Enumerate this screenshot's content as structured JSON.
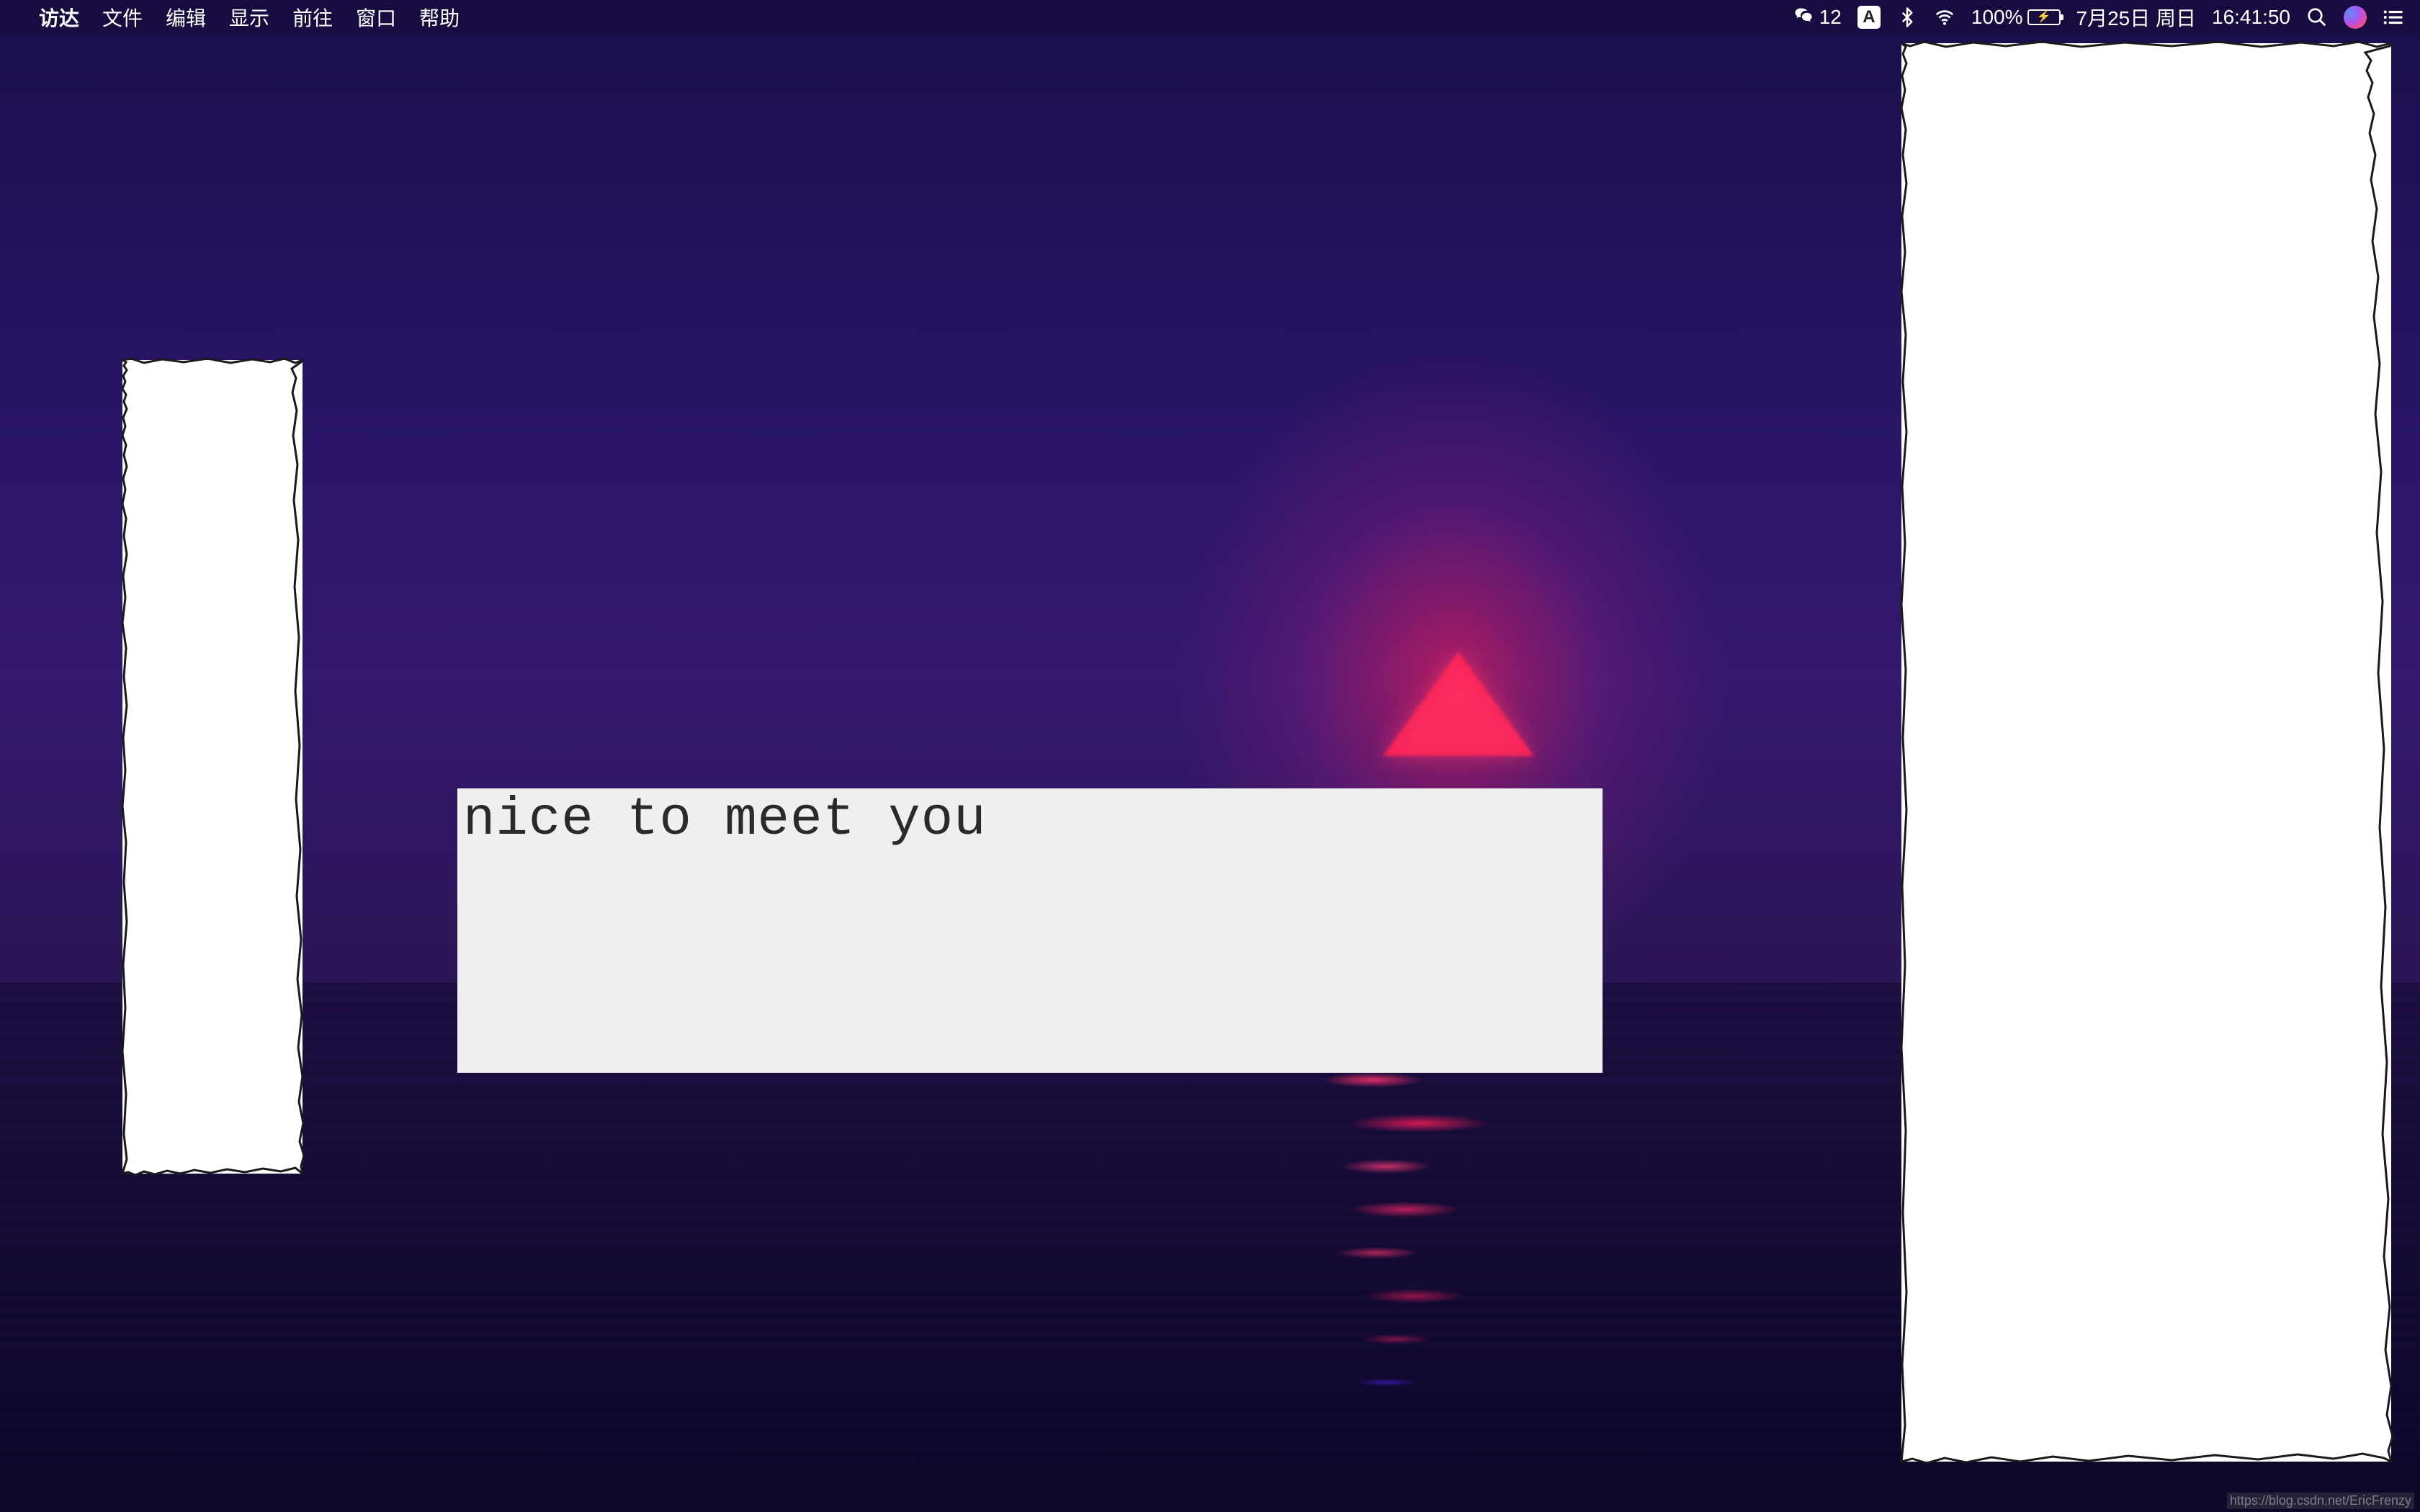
{
  "menubar": {
    "apple_icon": "",
    "app_name": "访达",
    "items": [
      "文件",
      "编辑",
      "显示",
      "前往",
      "窗口",
      "帮助"
    ]
  },
  "status": {
    "wechat_count": "12",
    "input_badge": "A",
    "battery_percent": "100%",
    "date": "7月25日 周日",
    "time": "16:41:50"
  },
  "center_window": {
    "text": "nice to meet you"
  },
  "watermark": {
    "text": "https://blog.csdn.net/EricFrenzy"
  }
}
